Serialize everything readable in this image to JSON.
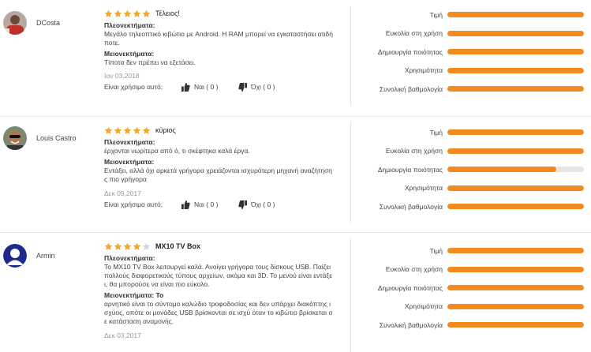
{
  "reviews": [
    {
      "user": "DCosta",
      "avatar_icon": "user-photo-avatar",
      "stars": 5,
      "title": "Τέλειος!",
      "pros_label": "Πλεονεκτήματα:",
      "pros": [
        "Μεγάλο τηλεοπτικό κιβώτιο με Android. Η RAM μπορεί να εγκαταστήσει οτιδή",
        "ποτε."
      ],
      "cons_label": "Μειονεκτήματα:",
      "cons": [
        "Τίποτα δεν πρέπει να εξετάσει."
      ],
      "date": "Ιαν 03,2018",
      "helpful_q": "Είναι χρήσιμο αυτό;",
      "yes": "Ναι ( 0 )",
      "no": "Όχι ( 0 )",
      "ratings": [
        {
          "label": "Τιμή",
          "value": 1.0
        },
        {
          "label": "Ευκολία στη χρήση",
          "value": 1.0
        },
        {
          "label": "Δημιουργία ποιότητας",
          "value": 1.0
        },
        {
          "label": "Χρησιμότητα",
          "value": 1.0
        },
        {
          "label": "Συνολική βαθμολογία",
          "value": 1.0
        }
      ]
    },
    {
      "user": "Louis Castro",
      "avatar_icon": "user-photo-avatar",
      "stars": 5,
      "title": "κύριος",
      "pros_label": "Πλεονεκτήματα:",
      "pros": [
        "έρχονται νωρίτερα από ό, τι σκέφτηκα καλά έργα."
      ],
      "cons_label": "Μειονεκτήματα:",
      "cons": [
        "Εντάξει, αλλά όχι αρκετά γρήγορα χρειάζονται ισχυρότερη μηχανή αναζήτηση",
        "ς πιο γρήγορα"
      ],
      "date": "Δεκ 09,2017",
      "helpful_q": "Είναι χρήσιμο αυτό;",
      "yes": "Ναι ( 0 )",
      "no": "Όχι ( 0 )",
      "ratings": [
        {
          "label": "Τιμή",
          "value": 1.0
        },
        {
          "label": "Ευκολία στη χρήση",
          "value": 1.0
        },
        {
          "label": "Δημιουργία ποιότητας",
          "value": 0.8
        },
        {
          "label": "Χρησιμότητα",
          "value": 1.0
        },
        {
          "label": "Συνολική βαθμολογία",
          "value": 1.0
        }
      ]
    },
    {
      "user": "Armin",
      "avatar_icon": "default-user-avatar",
      "stars": 4,
      "title": "MX10 TV Box",
      "pros_label": "Πλεονεκτήματα:",
      "pros": [
        "Το MX10 TV Box λειτουργεί καλά. Ανοίγει γρήγορα τους δίσκους USB. Παίζει",
        "πολλούς διαφορετικούς τύπους αρχείων, ακόμα και 3D. Το μενού είναι εντάξε",
        "ι, θα μπορούσε να είναι πιο εύκολο."
      ],
      "cons_label": "Μειονεκτήματα: Το",
      "cons": [
        "αρνητικό είναι το σύντομο καλώδιο τροφοδοσίας και δεν υπάρχει διακόπτης ι",
        "σχύος, οπότε οι μονάδες USB βρίσκονται σε ισχύ όταν το κιβώτιο βρίσκεται σ",
        "ε κατάσταση αναμονής."
      ],
      "date": "Δεκ 03,2017",
      "ratings": [
        {
          "label": "Τιμή",
          "value": 1.0
        },
        {
          "label": "Ευκολία στη χρήση",
          "value": 1.0
        },
        {
          "label": "Δημιουργία ποιότητας",
          "value": 1.0
        },
        {
          "label": "Χρησιμότητα",
          "value": 1.0
        },
        {
          "label": "Συνολική βαθμολογία",
          "value": 1.0
        }
      ]
    }
  ],
  "colors": {
    "star": "#f5a623",
    "bar_fill": "#f28a1f",
    "bar_track": "#e6e6e6"
  }
}
